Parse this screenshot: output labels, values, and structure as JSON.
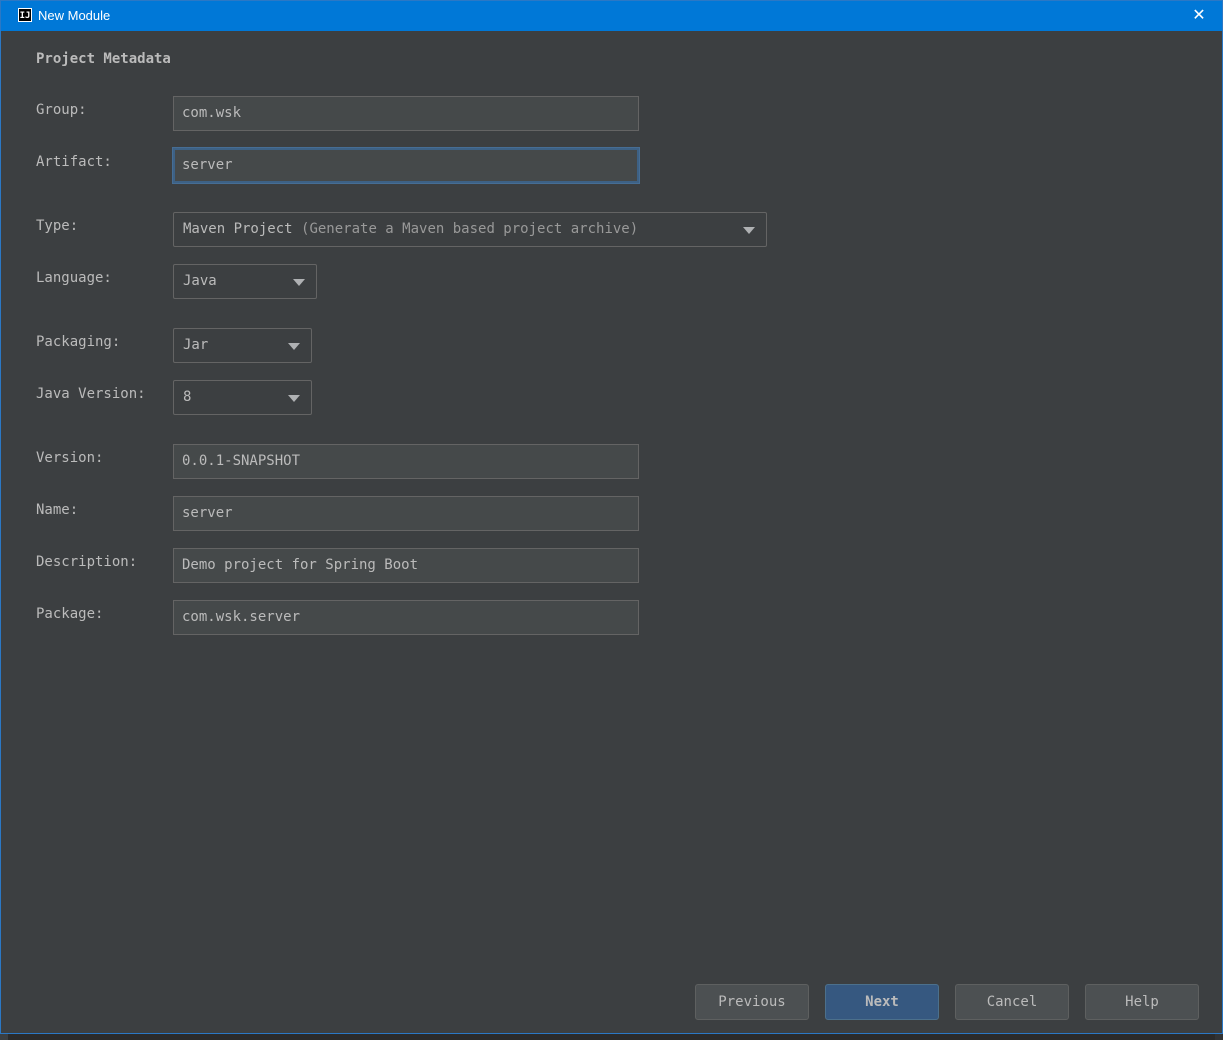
{
  "window": {
    "title": "New Module",
    "app_icon_text": "IJ"
  },
  "form": {
    "section_title": "Project Metadata",
    "group": {
      "label": "Group:",
      "value": "com.wsk"
    },
    "artifact": {
      "label": "Artifact:",
      "value": "server"
    },
    "type": {
      "label": "Type:",
      "value": "Maven Project",
      "hint": "(Generate a Maven based project archive)"
    },
    "language": {
      "label": "Language:",
      "value": "Java"
    },
    "packaging": {
      "label": "Packaging:",
      "value": "Jar"
    },
    "java_version": {
      "label": "Java Version:",
      "value": "8"
    },
    "version": {
      "label": "Version:",
      "value": "0.0.1-SNAPSHOT"
    },
    "name": {
      "label": "Name:",
      "value": "server"
    },
    "description": {
      "label": "Description:",
      "value": "Demo project for Spring Boot"
    },
    "package": {
      "label": "Package:",
      "value": "com.wsk.server"
    }
  },
  "buttons": {
    "previous": "Previous",
    "next": "Next",
    "cancel": "Cancel",
    "help": "Help"
  },
  "icons": {
    "close": "close-icon",
    "dropdown": "chevron-down-icon"
  },
  "colors": {
    "titlebar": "#0078d7",
    "dialog_bg": "#3c3f41",
    "field_bg": "#45494a",
    "focus_border": "#3d6185",
    "primary_button": "#365880"
  }
}
